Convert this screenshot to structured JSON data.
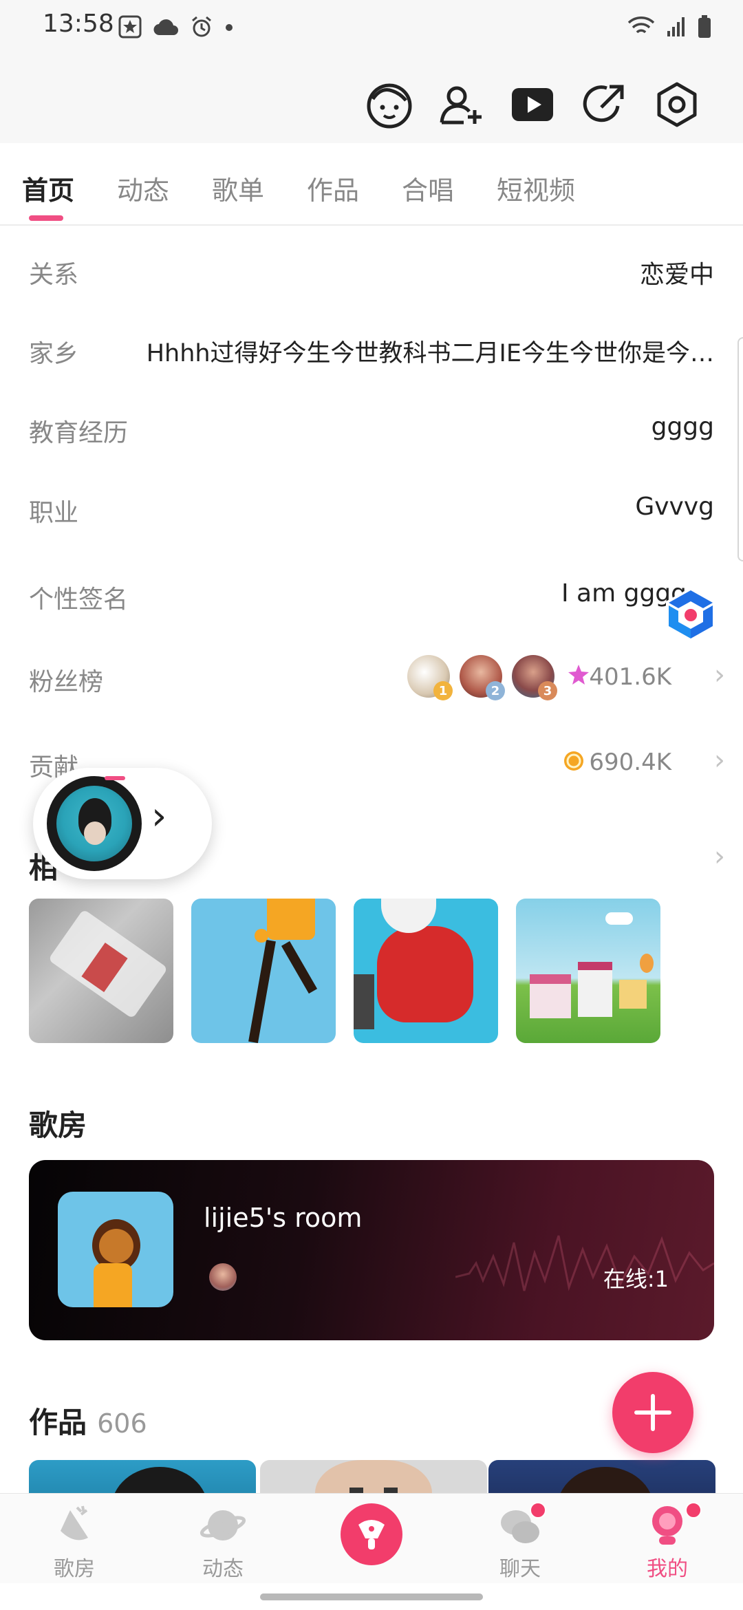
{
  "status_bar": {
    "time": "13:58"
  },
  "tabs": [
    {
      "label": "首页",
      "active": true
    },
    {
      "label": "动态"
    },
    {
      "label": "歌单"
    },
    {
      "label": "作品"
    },
    {
      "label": "合唱"
    },
    {
      "label": "短视频"
    }
  ],
  "profile": {
    "relationship": {
      "label": "关系",
      "value": "恋爱中"
    },
    "hometown": {
      "label": "家乡",
      "value": "Hhhh过得好今生今世教科书二月IE今生今世你是今…"
    },
    "education": {
      "label": "教育经历",
      "value": "gggg"
    },
    "job": {
      "label": "职业",
      "value": "Gvvvg"
    },
    "signature": {
      "label": "个性签名",
      "value": "I am gggg"
    },
    "fans": {
      "label": "粉丝榜",
      "value": "401.6K",
      "ranks": [
        "1",
        "2",
        "3"
      ]
    },
    "contribution": {
      "label": "贡献",
      "value": "690.4K"
    },
    "album": {
      "label": "相"
    }
  },
  "ktv": {
    "title": "歌房",
    "room_name": "lijie5's room",
    "online": "在线:1"
  },
  "works": {
    "title": "作品",
    "count": "606"
  },
  "nav": [
    {
      "label": "歌房"
    },
    {
      "label": "动态"
    },
    {
      "label": ""
    },
    {
      "label": "聊天"
    },
    {
      "label": "我的",
      "active": true
    }
  ],
  "colors": {
    "accent": "#f04e83",
    "fab": "#f23d6b"
  }
}
